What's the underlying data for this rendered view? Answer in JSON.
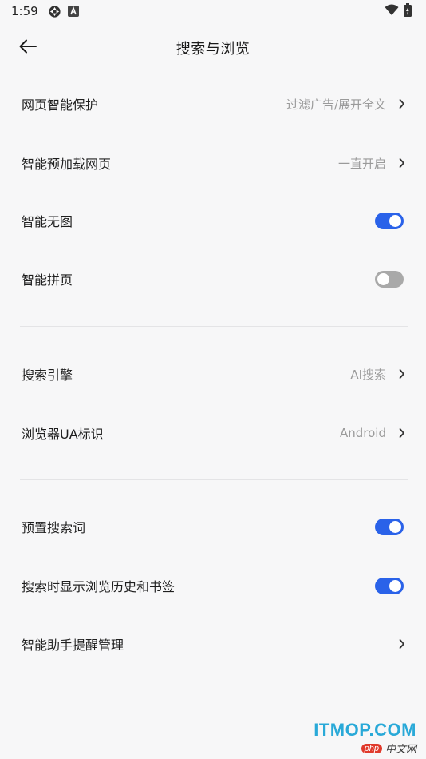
{
  "status_bar": {
    "time": "1:59",
    "icons_left": [
      "sync-icon",
      "app-a-icon"
    ],
    "icons_right": [
      "wifi-icon",
      "battery-icon"
    ]
  },
  "header": {
    "title": "搜索与浏览",
    "back_icon": "arrow-left-icon"
  },
  "settings": {
    "web_protection": {
      "label": "网页智能保护",
      "value": "过滤广告/展开全文"
    },
    "preload": {
      "label": "智能预加载网页",
      "value": "一直开启"
    },
    "no_image": {
      "label": "智能无图",
      "toggle": true
    },
    "page_join": {
      "label": "智能拼页",
      "toggle": false
    },
    "search_engine": {
      "label": "搜索引擎",
      "value": "AI搜索"
    },
    "ua": {
      "label": "浏览器UA标识",
      "value": "Android"
    },
    "preset_words": {
      "label": "预置搜索词",
      "toggle": true
    },
    "show_history": {
      "label": "搜索时显示浏览历史和书签",
      "toggle": true
    },
    "assistant": {
      "label": "智能助手提醒管理"
    }
  },
  "colors": {
    "accent": "#2a62e9",
    "toggle_off": "#a9a9a9",
    "background": "#f7f7f8",
    "value_text": "#9a9a9a"
  },
  "watermark": {
    "top": "ITMOP.COM",
    "php": "php",
    "cn": "中文网"
  }
}
